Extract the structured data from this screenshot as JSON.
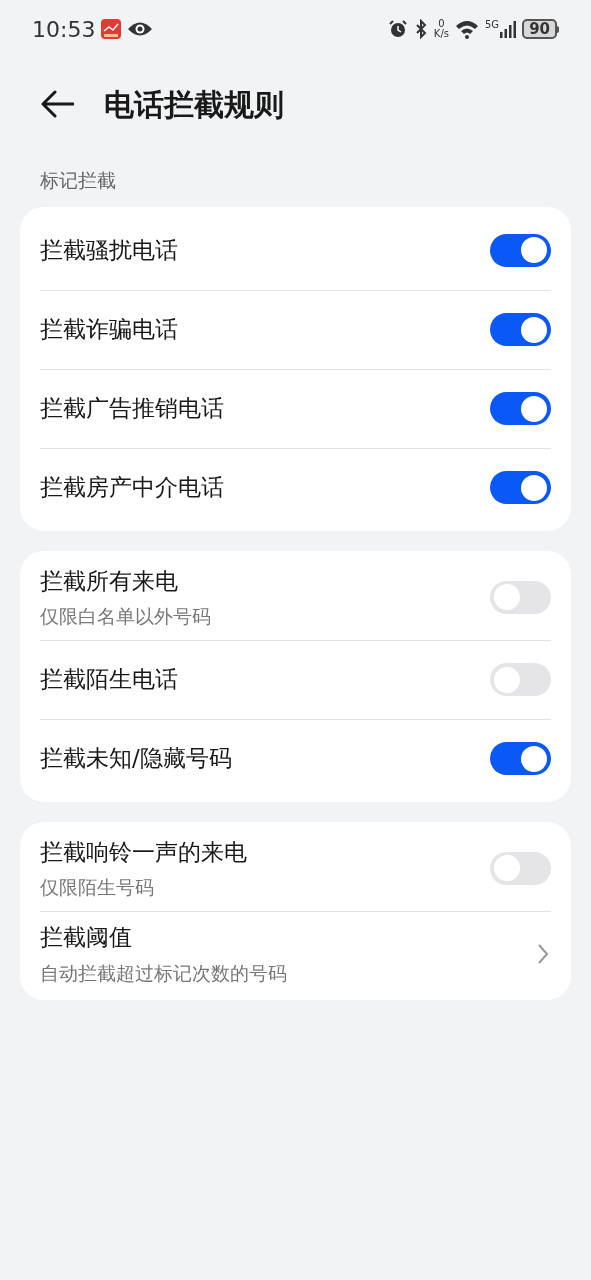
{
  "status_bar": {
    "time": "10:53",
    "speed_value": "0",
    "speed_unit": "K/s",
    "network": "5G",
    "battery": "90"
  },
  "header": {
    "title": "电话拦截规则"
  },
  "groups": [
    {
      "label": "标记拦截",
      "items": [
        {
          "kind": "toggle",
          "title": "拦截骚扰电话",
          "on": true
        },
        {
          "kind": "toggle",
          "title": "拦截诈骗电话",
          "on": true
        },
        {
          "kind": "toggle",
          "title": "拦截广告推销电话",
          "on": true
        },
        {
          "kind": "toggle",
          "title": "拦截房产中介电话",
          "on": true
        }
      ]
    },
    {
      "items": [
        {
          "kind": "toggle",
          "title": "拦截所有来电",
          "subtitle": "仅限白名单以外号码",
          "on": false
        },
        {
          "kind": "toggle",
          "title": "拦截陌生电话",
          "on": false
        },
        {
          "kind": "toggle",
          "title": "拦截未知/隐藏号码",
          "on": true
        }
      ]
    },
    {
      "items": [
        {
          "kind": "toggle",
          "title": "拦截响铃一声的来电",
          "subtitle": "仅限陌生号码",
          "on": false
        },
        {
          "kind": "link",
          "title": "拦截阈值",
          "subtitle": "自动拦截超过标记次数的号码"
        }
      ]
    }
  ]
}
